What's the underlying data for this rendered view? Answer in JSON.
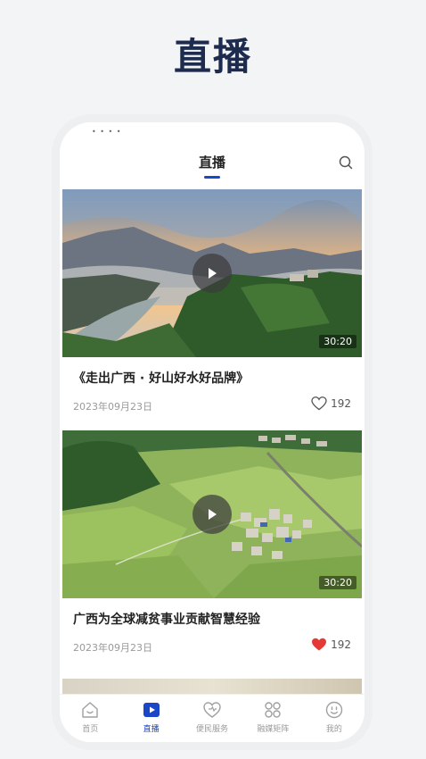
{
  "promo": {
    "title": "直播"
  },
  "status_bar": {
    "dots": "• • • •"
  },
  "topbar": {
    "title": "直播"
  },
  "videos": [
    {
      "title": "《走出广西 · 好山好水好品牌》",
      "date": "2023年09月23日",
      "likes": "192",
      "liked": false,
      "duration": "30:20"
    },
    {
      "title": "广西为全球减贫事业贡献智慧经验",
      "date": "2023年09月23日",
      "likes": "192",
      "liked": true,
      "duration": "30:20"
    }
  ],
  "tabs": [
    {
      "label": "首页",
      "icon": "home-icon",
      "active": false
    },
    {
      "label": "直播",
      "icon": "live-play-icon",
      "active": true
    },
    {
      "label": "便民服务",
      "icon": "service-heart-icon",
      "active": false
    },
    {
      "label": "融媒矩阵",
      "icon": "matrix-icon",
      "active": false
    },
    {
      "label": "我的",
      "icon": "profile-icon",
      "active": false
    }
  ],
  "colors": {
    "accent": "#1a46c8",
    "like_red": "#e53935",
    "title_navy": "#1d2b4f"
  }
}
